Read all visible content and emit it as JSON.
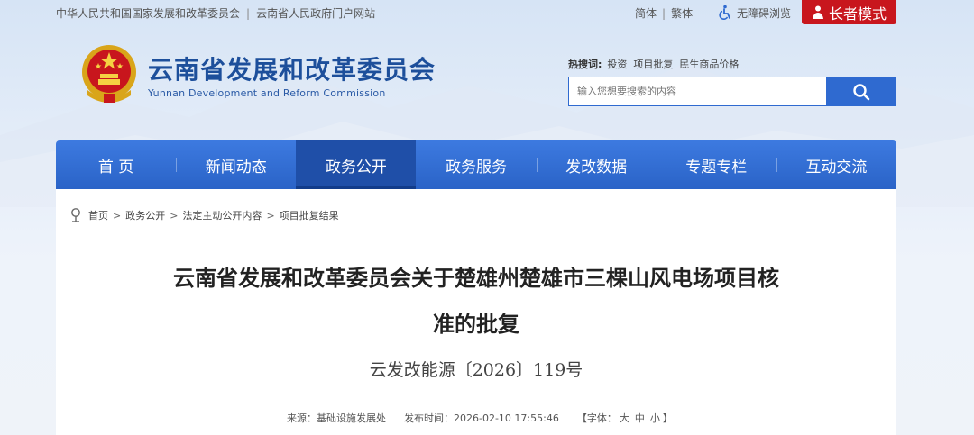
{
  "top": {
    "links": [
      "中华人民共和国国家发展和改革委员会",
      "云南省人民政府门户网站"
    ],
    "lang_simplified": "简体",
    "lang_traditional": "繁体",
    "accessibility": "无障碍浏览",
    "elder_mode": "长者模式"
  },
  "header": {
    "title": "云南省发展和改革委员会",
    "subtitle": "Yunnan Development and Reform Commission",
    "hot_label": "热搜词:",
    "hot_words": [
      "投资",
      "项目批复",
      "民生商品价格"
    ],
    "search_placeholder": "输入您想要搜索的内容"
  },
  "nav": [
    "首 页",
    "新闻动态",
    "政务公开",
    "政务服务",
    "发改数据",
    "专题专栏",
    "互动交流"
  ],
  "breadcrumb": [
    "首页",
    "政务公开",
    "法定主动公开内容",
    "项目批复结果"
  ],
  "article": {
    "title_line1": "云南省发展和改革委员会关于楚雄州楚雄市三棵山风电场项目核",
    "title_line2": "准的批复",
    "doc_number": "云发改能源〔2026〕119号",
    "source": "来源：基础设施发展处",
    "publish_time": "发布时间：2026-02-10 17:55:46",
    "font_size_label": "【字体：",
    "font_large": "大",
    "font_medium": "中",
    "font_small": "小",
    "font_close": "】"
  },
  "colors": {
    "brand_blue": "#2a63c7",
    "active_blue": "#1f4fa8",
    "elder_red": "#c8161d"
  }
}
